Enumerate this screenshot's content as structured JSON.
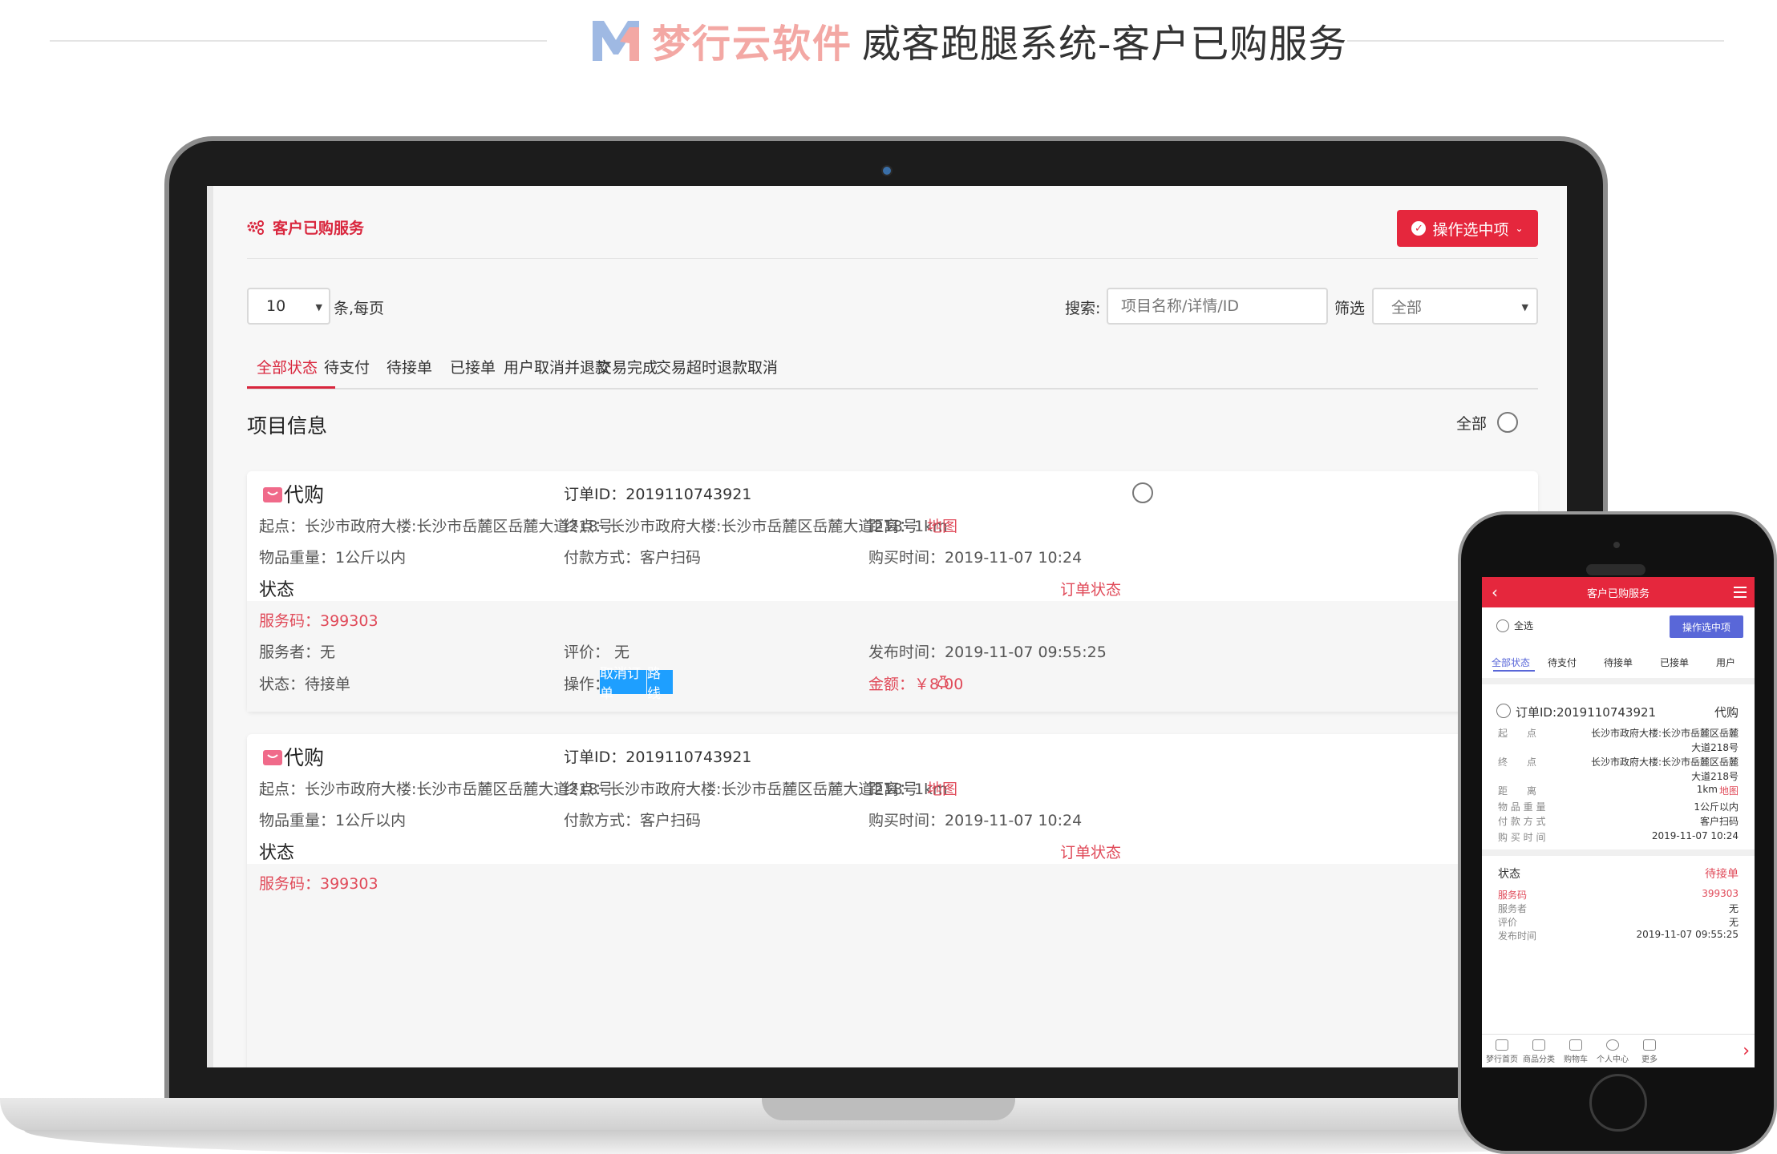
{
  "banner": {
    "brand": "梦行云软件",
    "title": "威客跑腿系统-客户已购服务"
  },
  "desktop": {
    "panel_title": "客户已购服务",
    "op_button": "操作选中项",
    "page_size": "10",
    "per_page_label": "条,每页",
    "search_label": "搜索:",
    "search_placeholder": "项目名称/详情/ID",
    "filter_label": "筛选",
    "filter_value": "全部",
    "tabs": [
      "全部状态",
      "待支付",
      "待接单",
      "已接单",
      "用户取消并退款",
      "交易完成",
      "交易超时退款取消"
    ],
    "section_title": "项目信息",
    "select_all": "全部",
    "orders": [
      {
        "type": "代购",
        "order_id": "订单ID：2019110743921",
        "start": "起点：长沙市政府大楼:长沙市岳麓区岳麓大道218号",
        "end": "终点：长沙市政府大楼:长沙市岳麓区岳麓大道218号",
        "distance": "距离：1km",
        "map_link": "地图",
        "weight": "物品重量：1公斤以内",
        "payment": "付款方式：客户扫码",
        "buy_time": "购买时间：2019-11-07 10:24",
        "status_title": "状态",
        "status_link": "订单状态",
        "service_code": "服务码：399303",
        "server": "服务者：无",
        "rating": "评价：  无",
        "publish_time": "发布时间：2019-11-07 09:55:25",
        "state": "状态：待接单",
        "op_label": "操作：",
        "cancel_btn": "取消订单",
        "route_btn": "路线",
        "amount": "金额：￥8.00"
      },
      {
        "type": "代购",
        "order_id": "订单ID：2019110743921",
        "start": "起点：长沙市政府大楼:长沙市岳麓区岳麓大道218号",
        "end": "终点：长沙市政府大楼:长沙市岳麓区岳麓大道218号",
        "distance": "距离：1km",
        "map_link": "地图",
        "weight": "物品重量：1公斤以内",
        "payment": "付款方式：客户扫码",
        "buy_time": "购买时间：2019-11-07 10:24",
        "status_title": "状态",
        "status_link": "订单状态",
        "service_code": "服务码：399303"
      }
    ]
  },
  "mobile": {
    "header_title": "客户已购服务",
    "select_all": "全选",
    "op_button": "操作选中项",
    "tabs": [
      "全部状态",
      "待支付",
      "待接单",
      "已接单",
      "用户"
    ],
    "order": {
      "order_id": "订单ID:2019110743921",
      "type": "代购",
      "start_label": "起　　点",
      "start_line1": "长沙市政府大楼:长沙市岳麓区岳麓",
      "start_line2": "大道218号",
      "end_label": "终　　点",
      "end_line1": "长沙市政府大楼:长沙市岳麓区岳麓",
      "end_line2": "大道218号",
      "distance_label": "距　　离",
      "distance": "1km",
      "map_link": "地图",
      "weight_label": "物 品 重 量",
      "weight": "1公斤以内",
      "payment_label": "付 款 方 式",
      "payment": "客户扫码",
      "buy_label": "购 买 时 间",
      "buy_time": "2019-11-07 10:24",
      "status_title": "状态",
      "status_value": "待接单",
      "code_label": "服务码",
      "code": "399303",
      "server_label": "服务者",
      "server": "无",
      "rating_label": "评价",
      "rating": "无",
      "publish_label": "发布时间",
      "publish_time": "2019-11-07 09:55:25"
    },
    "nav": [
      "梦行首页",
      "商品分类",
      "购物车",
      "个人中心",
      "更多"
    ]
  },
  "colors": {
    "accent_red": "#e5273d",
    "link_red": "#e04a59",
    "mobile_accent": "#5967d8",
    "button_blue": "#1e9fff"
  }
}
